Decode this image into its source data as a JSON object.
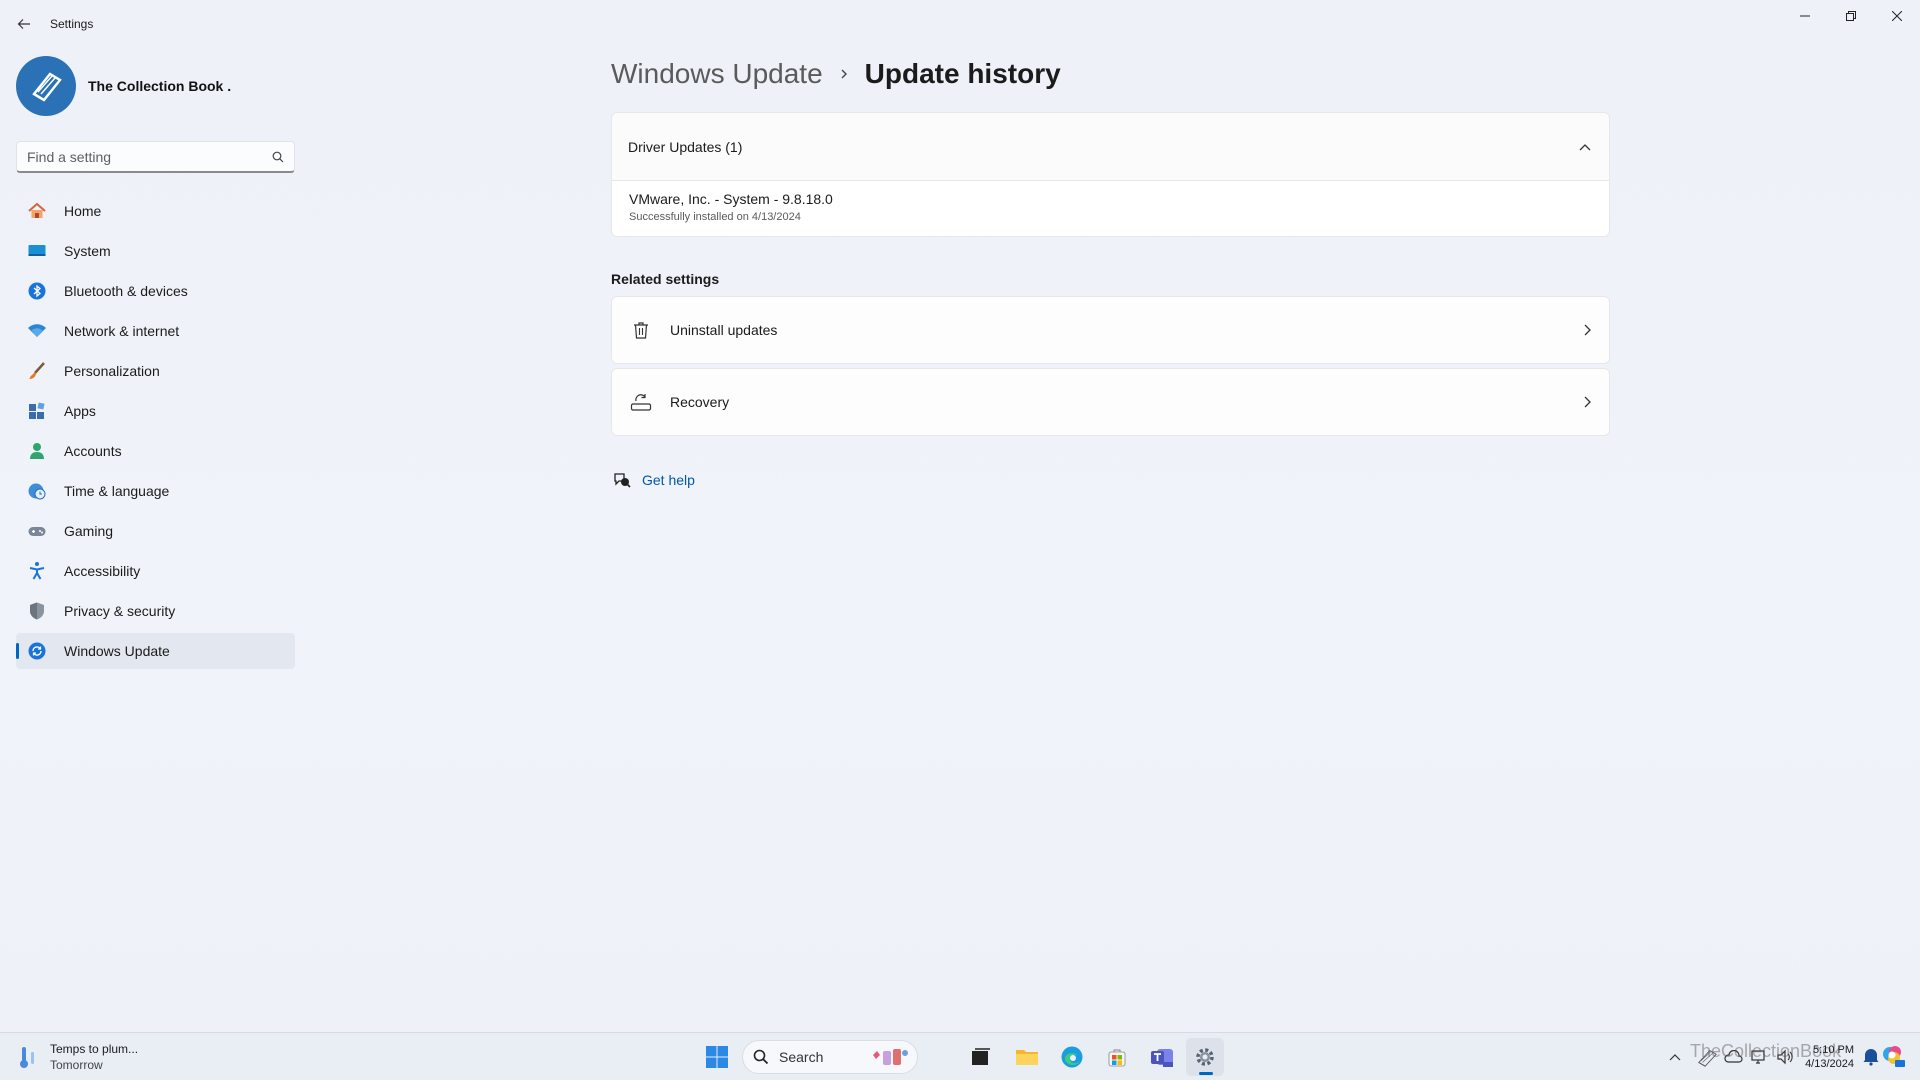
{
  "window": {
    "title": "Settings",
    "back_icon": "arrow-left-icon",
    "controls": [
      "minimize-icon",
      "restore-icon",
      "close-icon"
    ]
  },
  "profile": {
    "name": "The Collection Book ."
  },
  "search": {
    "placeholder": "Find a setting"
  },
  "sidebar": {
    "items": [
      {
        "label": "Home",
        "icon": "home-icon"
      },
      {
        "label": "System",
        "icon": "monitor-icon"
      },
      {
        "label": "Bluetooth & devices",
        "icon": "bluetooth-icon"
      },
      {
        "label": "Network & internet",
        "icon": "wifi-icon"
      },
      {
        "label": "Personalization",
        "icon": "brush-icon"
      },
      {
        "label": "Apps",
        "icon": "apps-icon"
      },
      {
        "label": "Accounts",
        "icon": "person-icon"
      },
      {
        "label": "Time & language",
        "icon": "globe-clock-icon"
      },
      {
        "label": "Gaming",
        "icon": "gamepad-icon"
      },
      {
        "label": "Accessibility",
        "icon": "accessibility-icon"
      },
      {
        "label": "Privacy & security",
        "icon": "shield-icon"
      },
      {
        "label": "Windows Update",
        "icon": "sync-icon",
        "active": true
      }
    ]
  },
  "breadcrumb": {
    "parent": "Windows Update",
    "current": "Update history"
  },
  "driver_updates": {
    "header": "Driver Updates (1)",
    "items": [
      {
        "name": "VMware, Inc. - System - 9.8.18.0",
        "status": "Successfully installed on 4/13/2024"
      }
    ]
  },
  "related": {
    "title": "Related settings",
    "uninstall": "Uninstall updates",
    "recovery": "Recovery"
  },
  "help": {
    "label": "Get help"
  },
  "taskbar": {
    "weather_main": "Temps to plum...",
    "weather_sub": "Tomorrow",
    "search_label": "Search",
    "time": "5:10 PM",
    "date": "4/13/2024",
    "watermark": "TheCollectionBook"
  },
  "colors": {
    "accent": "#0067c0",
    "link": "#0058a8",
    "background": "#eef2f8"
  }
}
